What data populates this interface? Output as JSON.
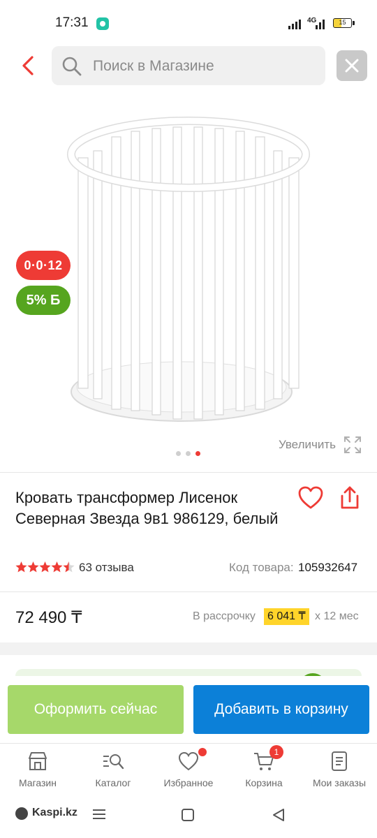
{
  "status": {
    "time": "17:31",
    "network": "4G",
    "battery": "15"
  },
  "search": {
    "placeholder": "Поиск в Магазине"
  },
  "icons": {
    "back": "chevron-left-icon",
    "search": "search-icon",
    "clear": "close-icon",
    "zoom": "expand-icon",
    "favorite": "heart-icon",
    "share": "share-icon"
  },
  "gallery": {
    "installment_badge": "0·0·12",
    "bonus_badge": "5% Б",
    "zoom_label": "Увеличить",
    "pages": 3,
    "active_page": 3
  },
  "product": {
    "title": "Кровать трансформер Лисенок Северная Звезда 9в1 986129, белый",
    "rating": 4.5,
    "reviews": "63 отзыва",
    "sku_label": "Код товара:",
    "sku_value": "105932647",
    "price": "72 490 ₸",
    "installment_label": "В рассрочку",
    "installment_amount": "6 041 ₸",
    "installment_term": "х 12 мес"
  },
  "actions": {
    "buy_now": "Оформить сейчас",
    "add_to_cart": "Добавить в корзину"
  },
  "tabs": [
    {
      "label": "Магазин",
      "icon": "store-icon"
    },
    {
      "label": "Каталог",
      "icon": "catalog-search-icon"
    },
    {
      "label": "Избранное",
      "icon": "heart-icon",
      "dot": true
    },
    {
      "label": "Корзина",
      "icon": "cart-icon",
      "count": "1"
    },
    {
      "label": "Мои заказы",
      "icon": "orders-icon"
    }
  ],
  "system_nav": {
    "brand": "Kaspi.kz"
  },
  "colors": {
    "accent_red": "#ee3b35",
    "bonus_green": "#56a51f",
    "buy_green": "#a6d86a",
    "cart_blue": "#0c80d8",
    "installment_yellow": "#ffd42a"
  }
}
